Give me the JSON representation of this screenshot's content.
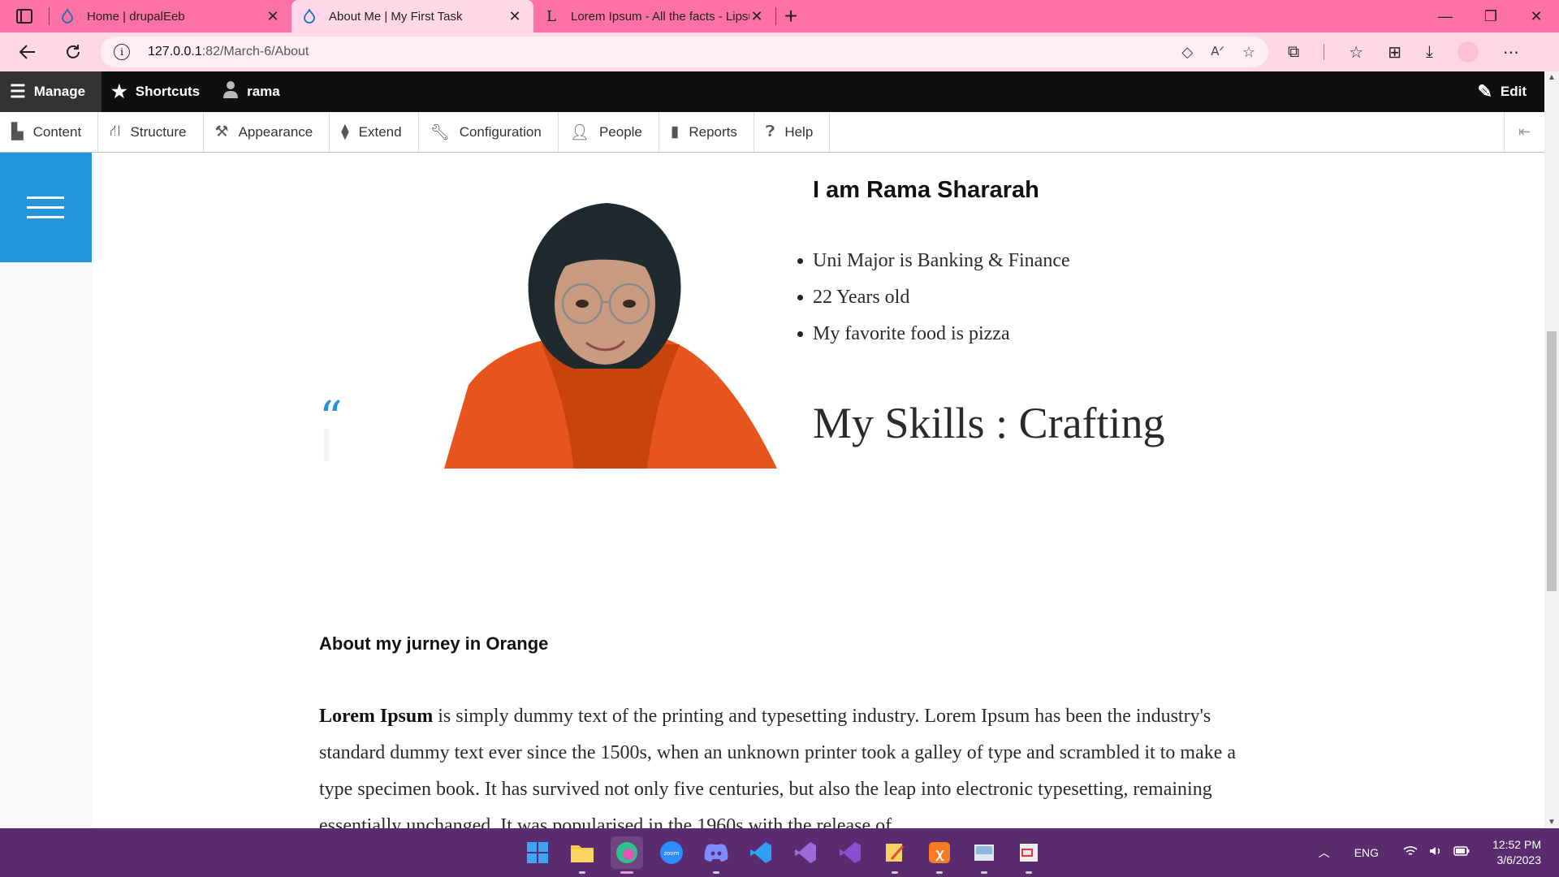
{
  "browser": {
    "tabs": [
      {
        "title": "Home | drupalEeb",
        "active": false
      },
      {
        "title": "About Me | My First Task",
        "active": true
      },
      {
        "title": "Lorem Ipsum - All the facts - Lipsum",
        "active": false
      }
    ],
    "url_host": "127.0.0.1",
    "url_path": ":82/March-6/About"
  },
  "toolbar": {
    "manage": "Manage",
    "shortcuts": "Shortcuts",
    "user": "rama",
    "edit": "Edit"
  },
  "tray": {
    "items": [
      "Content",
      "Structure",
      "Appearance",
      "Extend",
      "Configuration",
      "People",
      "Reports",
      "Help"
    ]
  },
  "page": {
    "quote_mark": "“",
    "intro_title": "I am Rama Shararah",
    "facts": [
      "Uni Major is Banking & Finance",
      "22 Years old",
      "My favorite food is pizza"
    ],
    "skills": "My Skills : Crafting",
    "journey_title": "About my jurney in Orange",
    "lorem_bold": "Lorem Ipsum",
    "lorem_text": " is simply dummy text of the printing and typesetting industry. Lorem Ipsum has been the industry's standard dummy text ever since the 1500s, when an unknown printer took a galley of type and scrambled it to make a type specimen book. It has survived not only five centuries, but also the leap into electronic typesetting, remaining essentially unchanged. It was popularised in the 1960s with the release of"
  },
  "taskbar": {
    "language": "ENG",
    "time": "12:52 PM",
    "date": "3/6/2023",
    "apps": [
      "windows-start-icon",
      "file-explorer-icon",
      "edge-browser-icon",
      "zoom-icon",
      "discord-icon",
      "vscode-icon",
      "visual-studio-icon",
      "visual-studio-preview-icon",
      "notepad-icon",
      "xampp-icon",
      "photos-icon",
      "snipping-tool-icon"
    ]
  },
  "colors": {
    "tabstrip": "#fd72a4",
    "addressbar": "#ffd8e7",
    "drupal_blue": "#2494db",
    "taskbar": "#5a2c6f"
  }
}
